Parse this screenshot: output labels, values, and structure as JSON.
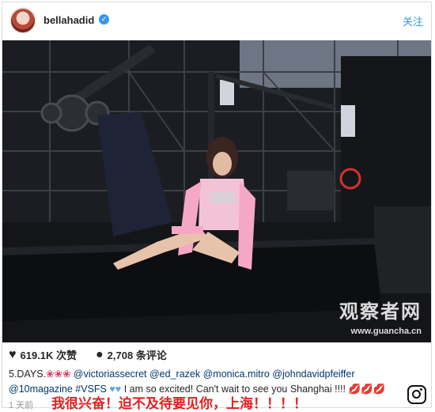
{
  "header": {
    "username": "bellahadid",
    "follow_label": "关注"
  },
  "photo": {
    "watermark_cn": "观察者网",
    "watermark_url": "www.guancha.cn"
  },
  "actions": {
    "likes": "619.1K 次赞",
    "comments": "2,708 条评论"
  },
  "caption": {
    "prefix": "5.DAYS.",
    "mention1": "@victoriassecret",
    "mention2": "@ed_razek",
    "mention3": "@monica.mitro",
    "mention4": "@johndavidpfeiffer",
    "mention5": "@10magazine",
    "hashtag": "#VSFS",
    "text": " I am so excited! Can't wait to see you Shanghai !!!!"
  },
  "footer": {
    "time": "1 天前",
    "overlay_cn": "我很兴奋！迫不及待要见你，上海！！！！"
  },
  "colors": {
    "link": "#3897f0",
    "overlay_text": "#e02020"
  }
}
